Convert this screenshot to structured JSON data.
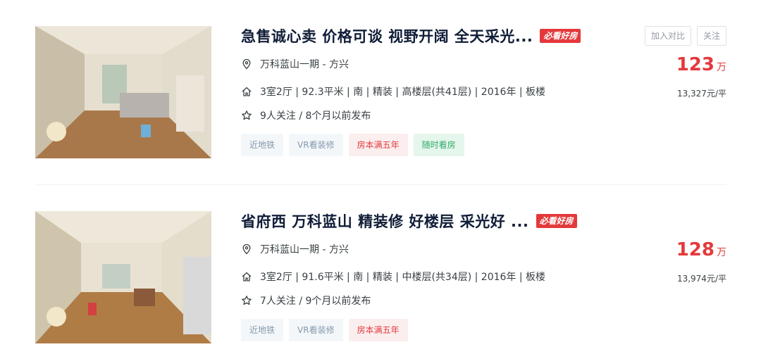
{
  "listings": [
    {
      "title": "急售诚心卖 价格可谈 视野开阔 全天采光...",
      "badge": "必看好房",
      "community": "万科蓝山一期 - 方兴",
      "house_info": "3室2厅 | 92.3平米 | 南 | 精装 | 高楼层(共41层) | 2016年 | 板楼",
      "follow_info": "9人关注 / 8个月以前发布",
      "tags": [
        "近地铁",
        "VR看装修",
        "房本满五年",
        "随时看房"
      ],
      "tag_colors": [
        "blue",
        "blue",
        "red",
        "green"
      ],
      "compare_label": "加入对比",
      "follow_label": "关注",
      "total_price": "123",
      "total_unit": "万",
      "unit_price": "13,327元/平"
    },
    {
      "title": "省府西 万科蓝山 精装修 好楼层 采光好 ...",
      "badge": "必看好房",
      "community": "万科蓝山一期 - 方兴",
      "house_info": "3室2厅 | 91.6平米 | 南 | 精装 | 中楼层(共34层) | 2016年 | 板楼",
      "follow_info": "7人关注 / 9个月以前发布",
      "tags": [
        "近地铁",
        "VR看装修",
        "房本满五年"
      ],
      "tag_colors": [
        "blue",
        "blue",
        "red"
      ],
      "total_price": "128",
      "total_unit": "万",
      "unit_price": "13,974元/平"
    }
  ],
  "icons": {
    "address": "location-pin-icon",
    "house": "house-icon",
    "follow": "star-icon"
  }
}
